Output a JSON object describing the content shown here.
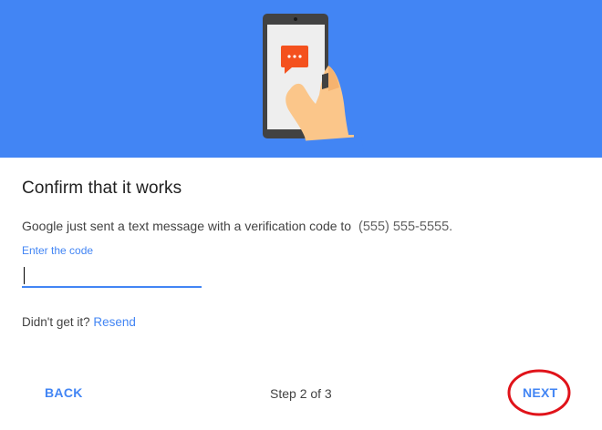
{
  "dialog": {
    "title": "Confirm that it works",
    "message": "Google just sent a text message with a verification code to",
    "phone_number": "(555) 555-5555.",
    "field_label": "Enter the code",
    "code_value": "",
    "resend_prompt": "Didn't get it?",
    "resend_link": "Resend"
  },
  "footer": {
    "back_label": "BACK",
    "step_text": "Step 2 of 3",
    "next_label": "NEXT"
  },
  "colors": {
    "accent": "#4285f4",
    "hero_background": "#4285f4",
    "message_bubble": "#f4511e",
    "highlight": "#e0131a"
  },
  "icons": {
    "hero_illustration": "hand-holding-phone-with-message-icon",
    "bubble": "chat-bubble-icon"
  }
}
